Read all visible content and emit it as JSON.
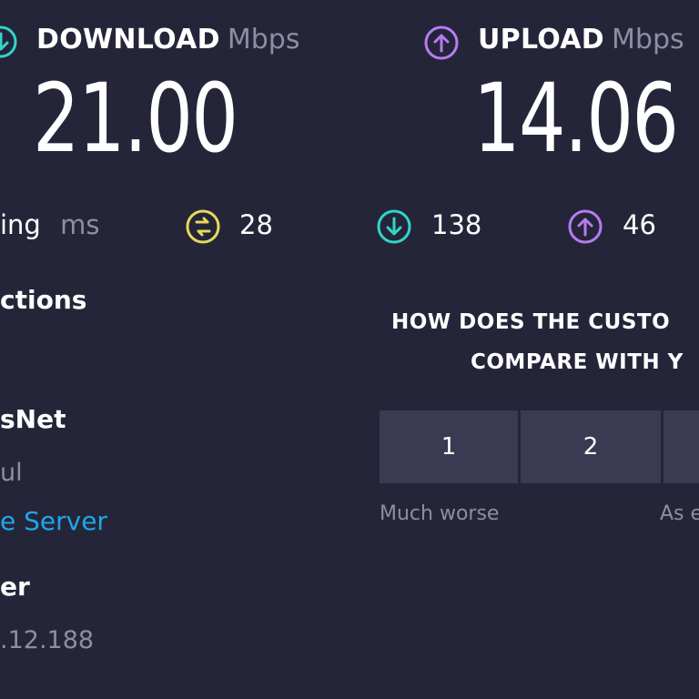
{
  "download": {
    "label": "DOWNLOAD",
    "unit": "Mbps",
    "value": "21.00",
    "icon": "download-icon",
    "color": "#2ed6c8"
  },
  "upload": {
    "label": "UPLOAD",
    "unit": "Mbps",
    "value": "14.06",
    "icon": "upload-icon",
    "color": "#b77cf0"
  },
  "ping": {
    "label_fragment": "ing",
    "unit": "ms",
    "jitter": "28",
    "download_latency": "138",
    "upload_latency": "46",
    "colors": {
      "jitter": "#e8d85a",
      "download": "#2ed6c8",
      "upload": "#b77cf0"
    }
  },
  "connections": {
    "title_fragment": "ctions",
    "provider_fragment": "sNet",
    "location_fragment": "ul",
    "change_server_fragment": "e Server",
    "server_title_fragment": "er",
    "ip_fragment": ".12.188"
  },
  "survey": {
    "question_line1": "HOW DOES THE CUSTO",
    "question_line2": "COMPARE WITH Y",
    "options": [
      "1",
      "2"
    ],
    "low_label": "Much worse",
    "mid_label_fragment": "As e"
  }
}
